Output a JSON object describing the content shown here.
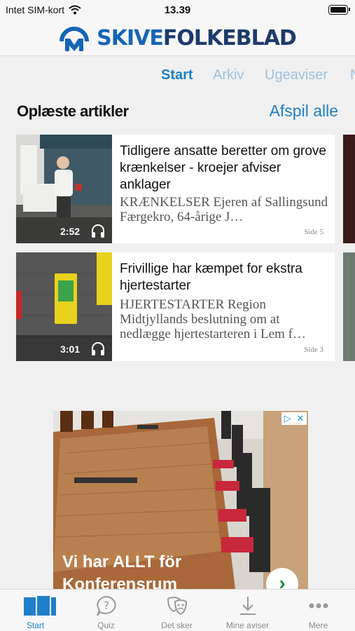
{
  "status_bar": {
    "carrier": "Intet SIM-kort",
    "time": "13.39"
  },
  "header": {
    "brand_part1": "SKIVE",
    "brand_part2": "FOLKEBLAD"
  },
  "tabs": [
    {
      "label": "Start"
    },
    {
      "label": "Arkiv"
    },
    {
      "label": "Ugeaviser"
    },
    {
      "label": "N"
    }
  ],
  "section": {
    "title": "Oplæste artikler",
    "action": "Afspil alle"
  },
  "articles": [
    {
      "title": "Tidligere ansatte beretter om grove krænkelser - kroejer afviser anklager",
      "excerpt": "KRÆNKELSER Ejeren af Sallingsund Færgekro, 64-årige J…",
      "page": "Side 5",
      "duration": "2:52"
    },
    {
      "title": "Frivillige har kæmpet for ekstra hjertestarter",
      "excerpt": "HJERTESTARTER Region Midtjyllands beslutning om at nedlægge hjertestarteren i Lem f…",
      "page": "Side 3",
      "duration": "3:01"
    }
  ],
  "ad": {
    "text_line1": "Vi har ALLT för",
    "text_line2": "Konferensrum"
  },
  "bottom_nav": [
    {
      "label": "Start",
      "icon": "newspapers-icon",
      "active": true
    },
    {
      "label": "Quiz",
      "icon": "quiz-bubble-icon"
    },
    {
      "label": "Det sker",
      "icon": "theater-masks-icon"
    },
    {
      "label": "Mine aviser",
      "icon": "download-icon"
    },
    {
      "label": "Mere",
      "icon": "more-dots-icon"
    }
  ],
  "colors": {
    "accent": "#1f7fc8",
    "brand_dark": "#1d3b6b",
    "brand_blue": "#1565b6",
    "tab_inactive": "#9fc0de"
  }
}
